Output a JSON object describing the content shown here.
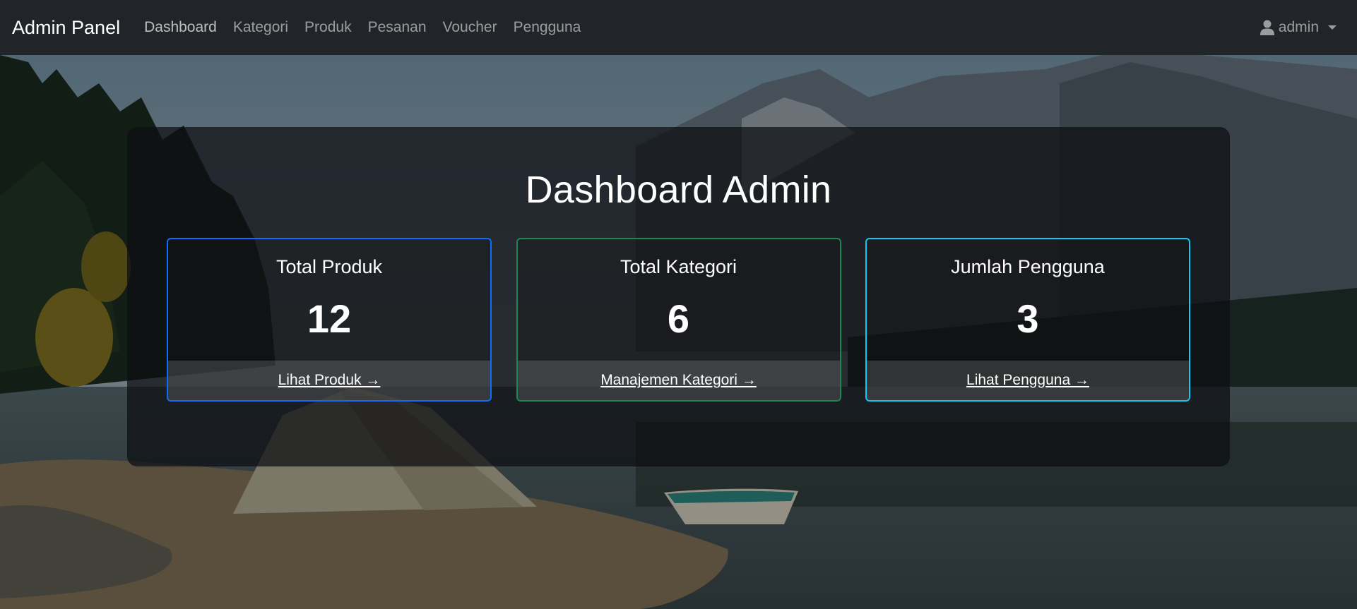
{
  "navbar": {
    "brand": "Admin Panel",
    "links": [
      {
        "label": "Dashboard"
      },
      {
        "label": "Kategori"
      },
      {
        "label": "Produk"
      },
      {
        "label": "Pesanan"
      },
      {
        "label": "Voucher"
      },
      {
        "label": "Pengguna"
      }
    ],
    "user": {
      "name": "admin",
      "icon": "user-icon"
    }
  },
  "main": {
    "title": "Dashboard Admin",
    "cards": [
      {
        "title": "Total Produk",
        "value": "12",
        "link": "Lihat Produk →",
        "accent": "#0d6efd"
      },
      {
        "title": "Total Kategori",
        "value": "6",
        "link": "Manajemen Kategori →",
        "accent": "#198754"
      },
      {
        "title": "Jumlah Pengguna",
        "value": "3",
        "link": "Lihat Pengguna →",
        "accent": "#0dcaf0"
      }
    ]
  },
  "colors": {
    "navbar_bg": "#212529",
    "panel_bg": "#0c0e12"
  }
}
